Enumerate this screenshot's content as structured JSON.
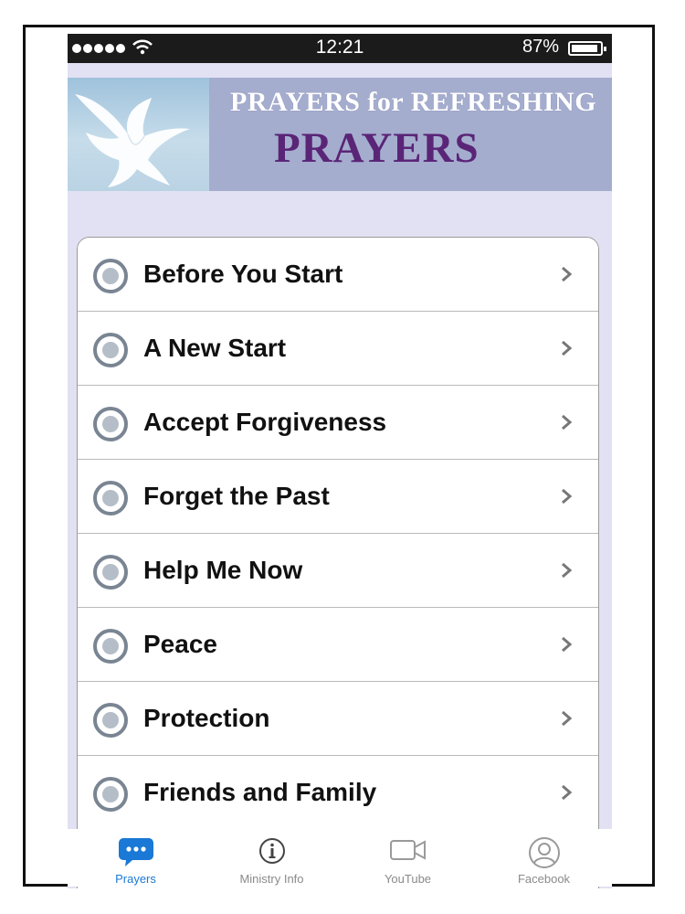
{
  "status_bar": {
    "time": "12:21",
    "battery": "87%"
  },
  "banner": {
    "title": "PRAYERS for REFRESHING",
    "subtitle": "PRAYERS"
  },
  "prayers": [
    {
      "label": "Before You Start"
    },
    {
      "label": "A New Start"
    },
    {
      "label": "Accept Forgiveness"
    },
    {
      "label": "Forget the Past"
    },
    {
      "label": "Help Me Now"
    },
    {
      "label": "Peace"
    },
    {
      "label": "Protection"
    },
    {
      "label": "Friends and Family"
    }
  ],
  "tabs": [
    {
      "label": "Prayers",
      "icon": "chat-bubble-icon",
      "active": true
    },
    {
      "label": "Ministry Info",
      "icon": "info-icon",
      "active": false
    },
    {
      "label": "YouTube",
      "icon": "video-camera-icon",
      "active": false
    },
    {
      "label": "Facebook",
      "icon": "person-icon",
      "active": false
    }
  ],
  "colors": {
    "accent": "#1a78d6",
    "banner_purple": "#5a2577",
    "banner_bg": "#a5adcf"
  }
}
